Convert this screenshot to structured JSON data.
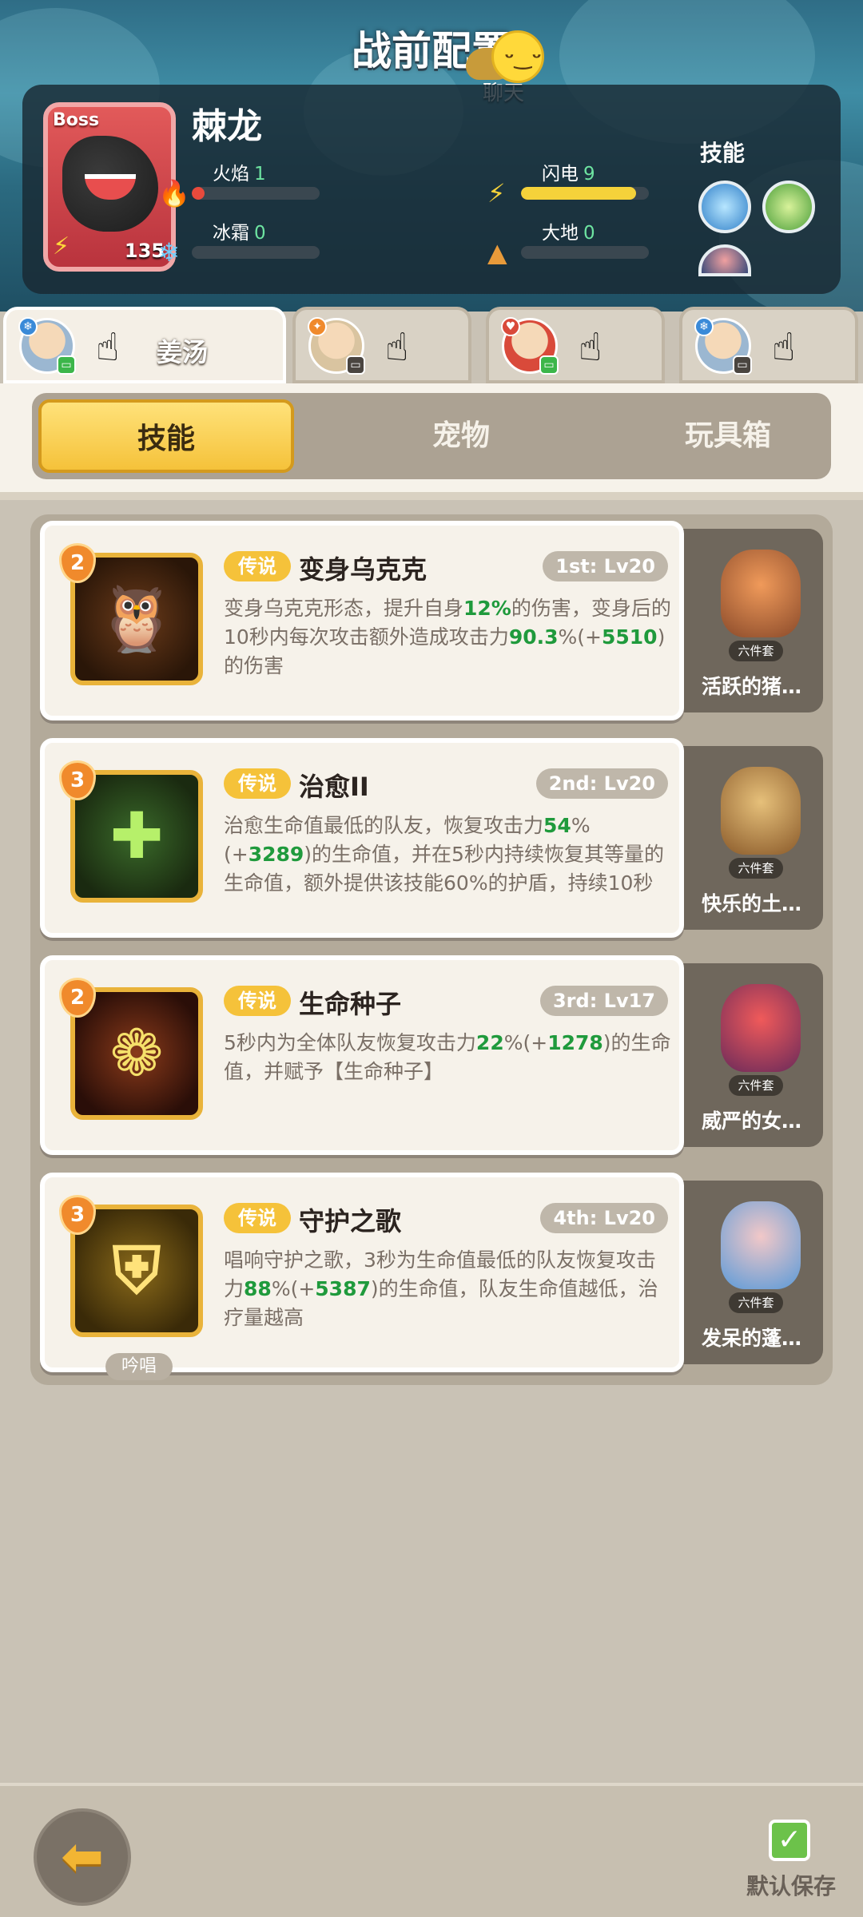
{
  "header": {
    "title": "战前配置",
    "chat_label": "聊天"
  },
  "boss": {
    "tag": "Boss",
    "name": "棘龙",
    "level": "135",
    "skills_title": "技能",
    "stats": [
      {
        "label": "火焰",
        "value": "1",
        "fill": 0.1,
        "icon": "fire-icon",
        "color": "#e84a3c"
      },
      {
        "label": "闪电",
        "value": "9",
        "fill": 0.9,
        "icon": "lightning-icon",
        "color": "#f5d23a"
      },
      {
        "label": "冰霜",
        "value": "0",
        "fill": 0.0,
        "icon": "snowflake-icon",
        "color": "#6fd0ff"
      },
      {
        "label": "大地",
        "value": "0",
        "fill": 0.0,
        "icon": "earth-icon",
        "color": "#e89a3a"
      }
    ]
  },
  "heroes": [
    {
      "name": "姜汤",
      "active": true
    },
    {
      "name": "",
      "active": false
    },
    {
      "name": "",
      "active": false
    },
    {
      "name": "",
      "active": false
    }
  ],
  "tabs": [
    "技能",
    "宠物",
    "玩具箱"
  ],
  "skills": [
    {
      "tier": "2",
      "tag": "传说",
      "name": "变身乌克克",
      "rank": "1st: Lv20",
      "icon": "owl-transform-icon",
      "desc_parts": [
        "变身乌克克形态，提升自身",
        "12%",
        "的伤害，变身后的10秒内每次攻击额外造成攻击力",
        "90.3",
        "%(+",
        "5510",
        ")的伤害"
      ],
      "pet": {
        "name": "活跃的猪…",
        "set": "六件套"
      }
    },
    {
      "tier": "3",
      "tag": "传说",
      "name": "治愈II",
      "rank": "2nd: Lv20",
      "icon": "heal-cross-icon",
      "desc_parts": [
        "治愈生命值最低的队友，恢复攻击力",
        "54",
        "%(+",
        "3289",
        ")的生命值，并在5秒内持续恢复其等量的生命值，额外提供该技能60%的护盾，持续10秒"
      ],
      "pet": {
        "name": "快乐的土…",
        "set": "六件套"
      }
    },
    {
      "tier": "2",
      "tag": "传说",
      "name": "生命种子",
      "rank": "3rd: Lv17",
      "icon": "seed-icon",
      "desc_parts": [
        "5秒内为全体队友恢复攻击力",
        "22",
        "%(+",
        "1278",
        ")的生命值，并赋予【生命种子】"
      ],
      "pet": {
        "name": "威严的女…",
        "set": "六件套"
      }
    },
    {
      "tier": "3",
      "tag": "传说",
      "name": "守护之歌",
      "rank": "4th: Lv20",
      "icon": "shield-song-icon",
      "chant": "吟唱",
      "desc_parts": [
        "唱响守护之歌，3秒为生命值最低的队友恢复攻击力",
        "88",
        "%(+",
        "5387",
        ")的生命值，队友生命值越低，治疗量越高"
      ],
      "pet": {
        "name": "发呆的蓬…",
        "set": "六件套"
      }
    }
  ],
  "footer": {
    "save_label": "默认保存"
  }
}
